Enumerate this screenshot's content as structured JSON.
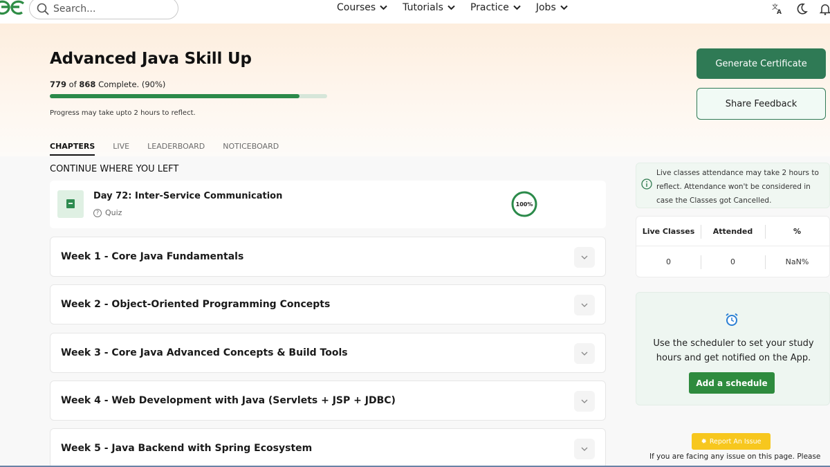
{
  "header": {
    "search_placeholder": "Search...",
    "nav": [
      {
        "label": "Courses"
      },
      {
        "label": "Tutorials"
      },
      {
        "label": "Practice"
      },
      {
        "label": "Jobs"
      }
    ],
    "icons": [
      "translate-icon",
      "moon-icon",
      "bell-icon"
    ],
    "brand_color": "#2f8d46"
  },
  "course": {
    "title": "Advanced Java Skill Up",
    "completed": "779",
    "total": "868",
    "complete_word": "Complete. (90%)",
    "of_word": "of",
    "progress_fraction": 0.9,
    "progress_note": "Progress may take upto 2 hours to reflect."
  },
  "actions": {
    "generate_certificate": "Generate Certificate",
    "share_feedback": "Share Feedback"
  },
  "tabs": [
    {
      "label": "CHAPTERS",
      "active": true
    },
    {
      "label": "LIVE",
      "active": false
    },
    {
      "label": "LEADERBOARD",
      "active": false
    },
    {
      "label": "NOTICEBOARD",
      "active": false
    }
  ],
  "continue": {
    "heading": "CONTINUE WHERE YOU LEFT",
    "item_title": "Day 72: Inter-Service Communication",
    "item_type": "Quiz",
    "item_progress": "100%",
    "item_progress_fraction": 1.0
  },
  "weeks": [
    {
      "title": "Week 1 - Core Java Fundamentals"
    },
    {
      "title": "Week 2 - Object-Oriented Programming Concepts"
    },
    {
      "title": "Week 3 - Core Java Advanced Concepts & Build Tools"
    },
    {
      "title": "Week 4 - Web Development with Java (Servlets + JSP + JDBC)"
    },
    {
      "title": "Week 5 - Java Backend with Spring Ecosystem"
    }
  ],
  "live_info": {
    "text": "Live classes attendance may take 2 hours to reflect. Attendance won't be considered in case the Classes got Cancelled."
  },
  "attendance": {
    "headers": [
      "Live Classes",
      "Attended",
      "%"
    ],
    "values": [
      "0",
      "0",
      "NaN%"
    ]
  },
  "scheduler": {
    "text": "Use the scheduler to set your study hours and get notified on the App.",
    "button": "Add a schedule"
  },
  "report": {
    "button": "Report An Issue",
    "note": "If you are facing any issue on this page. Please"
  }
}
